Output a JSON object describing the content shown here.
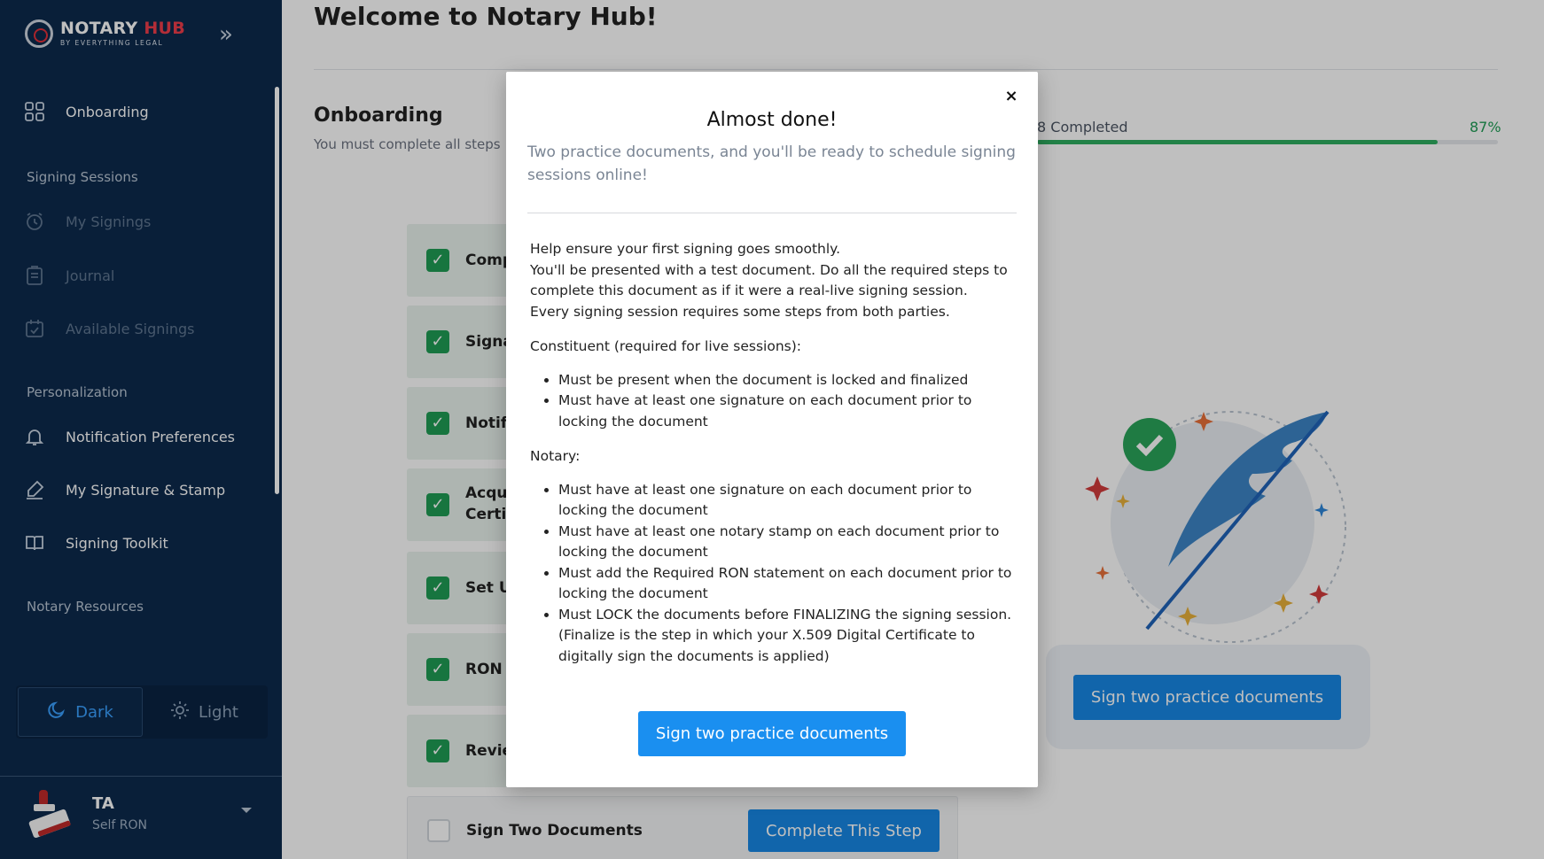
{
  "brand": {
    "name_primary": "NOTARY",
    "name_accent": "HUB",
    "tagline": "BY EVERYTHING LEGAL"
  },
  "sidebar": {
    "onboarding_label": "Onboarding",
    "sections": {
      "signing_sessions": "Signing Sessions",
      "personalization": "Personalization",
      "notary_resources": "Notary Resources"
    },
    "items": {
      "my_signings": "My Signings",
      "journal": "Journal",
      "available_signings": "Available Signings",
      "notification_preferences": "Notification Preferences",
      "my_signature_stamp": "My Signature & Stamp",
      "signing_toolkit": "Signing Toolkit"
    },
    "theme": {
      "dark_label": "Dark",
      "light_label": "Light",
      "active": "dark"
    },
    "user": {
      "name": "TA",
      "role": "Self RON"
    }
  },
  "main": {
    "page_title": "Welcome to Notary Hub!",
    "onboarding_title": "Onboarding",
    "onboarding_subtitle": "You must complete all steps",
    "progress_label": "8 Completed",
    "progress_percent_label": "87%",
    "progress_value": 0.87,
    "steps": [
      {
        "label": "Comp",
        "done": true
      },
      {
        "label": "Signa",
        "done": true
      },
      {
        "label": "Notifi",
        "done": true
      },
      {
        "label": "Acqu",
        "label2": "Certi",
        "done": true
      },
      {
        "label": "Set U",
        "done": true
      },
      {
        "label": "RON I",
        "done": true
      },
      {
        "label": "Revie",
        "done": true
      },
      {
        "label": "Sign Two Documents",
        "done": false,
        "button": "Complete This Step"
      }
    ],
    "illustration_button": "Sign two practice documents"
  },
  "modal": {
    "close_label": "×",
    "title": "Almost done!",
    "subtitle": "Two practice documents, and you'll be ready to schedule signing sessions online!",
    "intro_1": "Help ensure your first signing goes smoothly.",
    "intro_2": "You'll be presented with a test document. Do all the required steps to complete this document as if it were a real-live signing session.",
    "intro_3": "Every signing session requires some steps from both parties.",
    "constituent_heading": "Constituent (required for live sessions):",
    "constituent_items": [
      "Must be present when the document is locked and finalized",
      "Must have at least one signature on each document prior to locking the document"
    ],
    "notary_heading": "Notary:",
    "notary_items": [
      "Must have at least one signature on each document prior to locking the document",
      "Must have at least one notary stamp on each document prior to locking the document",
      "Must add the Required RON statement on each document prior to locking the document",
      "Must LOCK the documents before FINALIZING the signing session. (Finalize is the step in which your X.509 Digital Certificate to digitally sign the documents is applied)"
    ],
    "cta_label": "Sign two practice documents"
  },
  "colors": {
    "sidebar_bg": "#0d2a4d",
    "accent": "#1a8ff0",
    "success": "#1f9d55",
    "brand_red": "#ef3d4a"
  }
}
